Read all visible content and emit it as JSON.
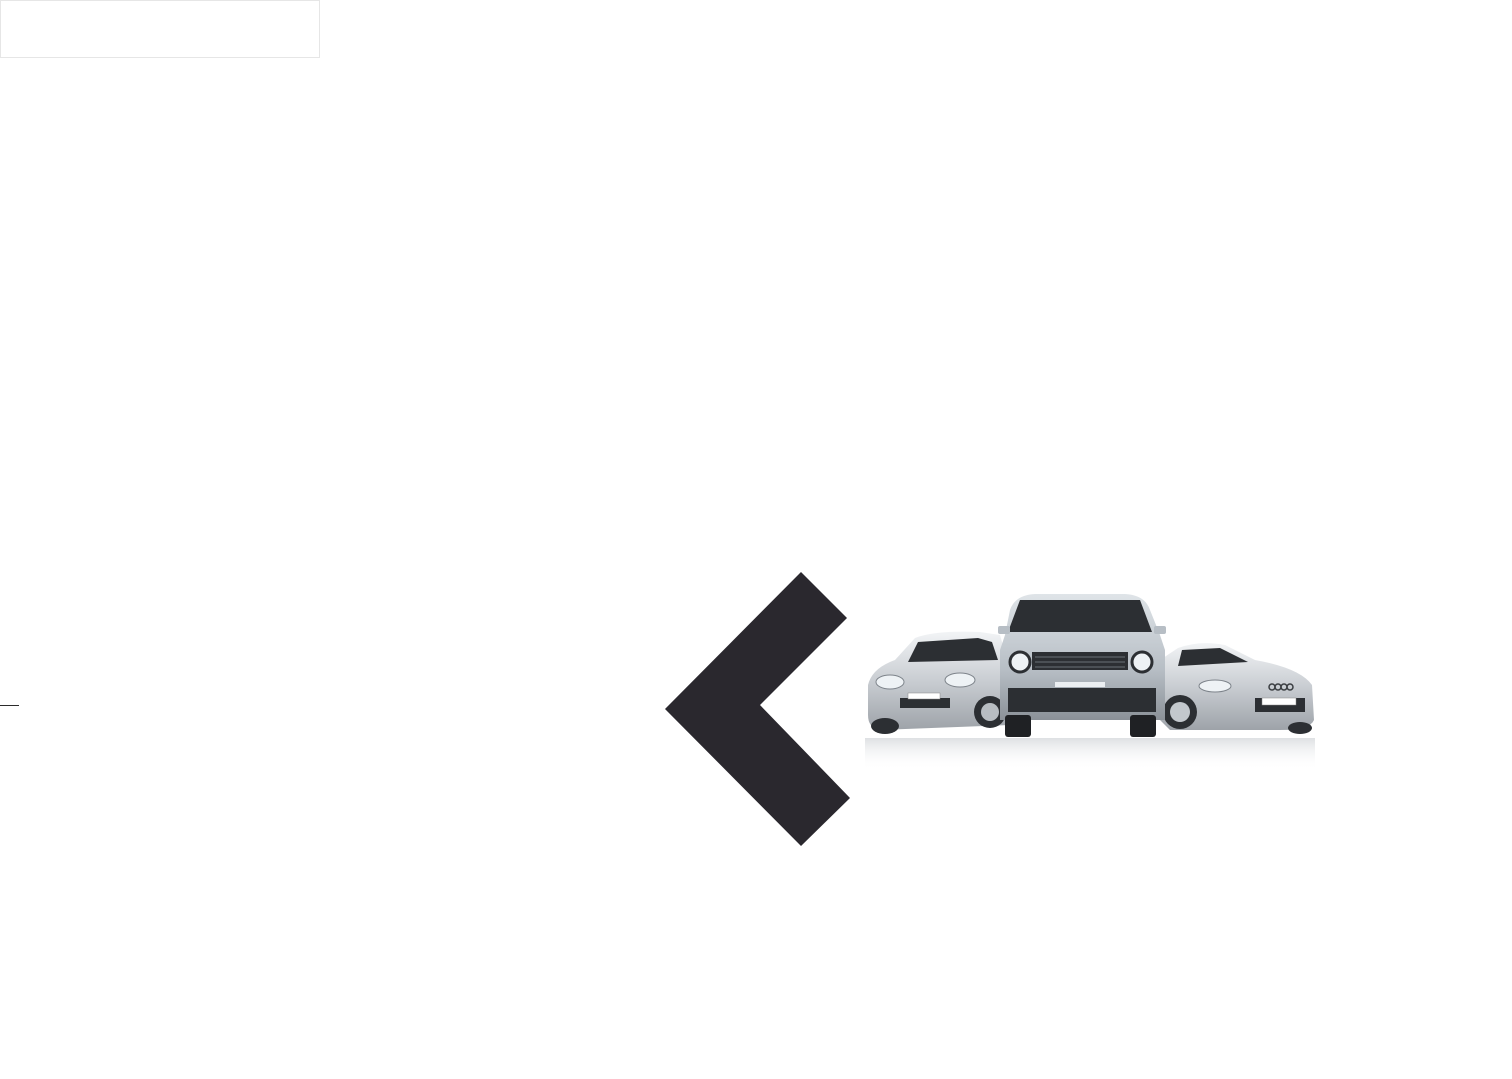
{
  "colors": {
    "background": "#ffffff",
    "arrow": "#2a282e",
    "car_silver": "#d9dce0",
    "car_dark": "#2c2f33"
  },
  "icons": {
    "back": "chevron-left-icon",
    "hero": "cars-lineup-image"
  }
}
